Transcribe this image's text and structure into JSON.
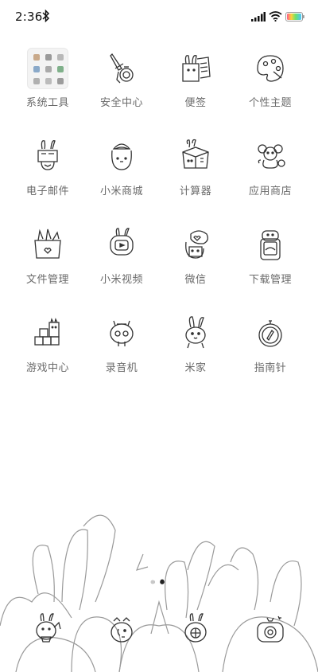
{
  "status_bar": {
    "time": "2:36"
  },
  "apps": [
    {
      "label": "系统工具",
      "icon": "system-tools-folder-icon"
    },
    {
      "label": "安全中心",
      "icon": "security-center-icon"
    },
    {
      "label": "便签",
      "icon": "notes-icon"
    },
    {
      "label": "个性主题",
      "icon": "themes-icon"
    },
    {
      "label": "电子邮件",
      "icon": "email-icon"
    },
    {
      "label": "小米商城",
      "icon": "mi-store-icon"
    },
    {
      "label": "计算器",
      "icon": "calculator-icon"
    },
    {
      "label": "应用商店",
      "icon": "app-store-icon"
    },
    {
      "label": "文件管理",
      "icon": "file-manager-icon"
    },
    {
      "label": "小米视频",
      "icon": "mi-video-icon"
    },
    {
      "label": "微信",
      "icon": "wechat-icon"
    },
    {
      "label": "下载管理",
      "icon": "downloads-icon"
    },
    {
      "label": "游戏中心",
      "icon": "game-center-icon"
    },
    {
      "label": "录音机",
      "icon": "recorder-icon"
    },
    {
      "label": "米家",
      "icon": "mi-home-icon"
    },
    {
      "label": "指南针",
      "icon": "compass-icon"
    }
  ],
  "dock": [
    {
      "icon": "phone-icon"
    },
    {
      "icon": "messages-icon"
    },
    {
      "icon": "browser-icon"
    },
    {
      "icon": "camera-icon"
    }
  ],
  "page_indicator": {
    "pages": 2,
    "current": 2
  },
  "colors": {
    "text": "#6a6a6a",
    "line": "#333333",
    "background": "#ffffff"
  }
}
